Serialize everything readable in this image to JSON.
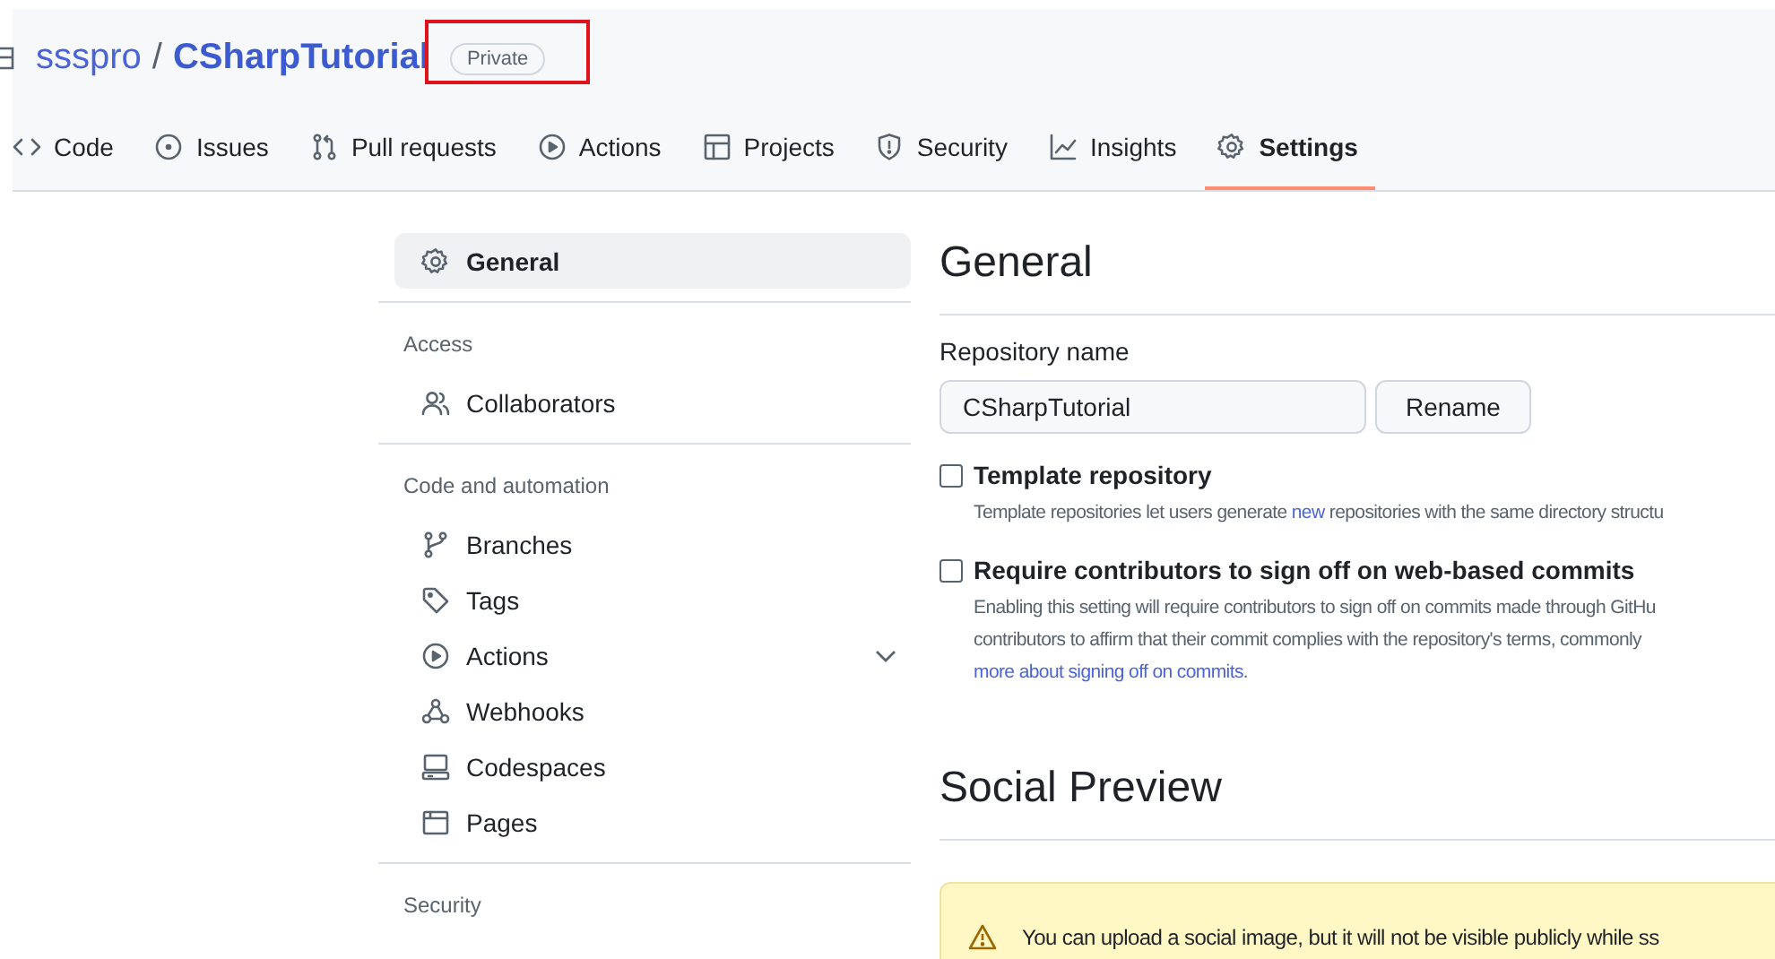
{
  "repo": {
    "owner": "ssspro",
    "separator": "/",
    "name": "CSharpTutorial",
    "visibility": "Private",
    "highlighted": true
  },
  "tabs": [
    {
      "label": "Code",
      "selected": false
    },
    {
      "label": "Issues",
      "selected": false
    },
    {
      "label": "Pull requests",
      "selected": false
    },
    {
      "label": "Actions",
      "selected": false
    },
    {
      "label": "Projects",
      "selected": false
    },
    {
      "label": "Security",
      "selected": false
    },
    {
      "label": "Insights",
      "selected": false
    },
    {
      "label": "Settings",
      "selected": true
    }
  ],
  "sidebar": {
    "sections": [
      {
        "items": [
          {
            "label": "General",
            "selected": true
          }
        ]
      },
      {
        "heading": "Access",
        "items": [
          {
            "label": "Collaborators",
            "selected": false
          }
        ]
      },
      {
        "heading": "Code and automation",
        "items": [
          {
            "label": "Branches",
            "selected": false
          },
          {
            "label": "Tags",
            "selected": false
          },
          {
            "label": "Actions",
            "selected": false,
            "expanded": false
          },
          {
            "label": "Webhooks",
            "selected": false
          },
          {
            "label": "Codespaces",
            "selected": false
          },
          {
            "label": "Pages",
            "selected": false
          }
        ]
      },
      {
        "heading": "Security"
      }
    ]
  },
  "main": {
    "title": "General",
    "field": {
      "label": "Repository name",
      "value": "CSharpTutorial",
      "button": "Rename"
    },
    "options": [
      {
        "label": "Template repository",
        "checked": false,
        "description": [
          [
            {
              "text": "Template repositories let users generate ",
              "link": false
            },
            {
              "text": "new",
              "link": true
            },
            {
              "text": " repositories with the same directory structu",
              "link": false
            }
          ]
        ]
      },
      {
        "label": "Require contributors to sign off on web-based commits",
        "checked": false,
        "description": [
          [
            {
              "text": "Enabling this setting will require contributors to sign off on commits made through GitHu",
              "link": false
            }
          ],
          [
            {
              "text": "contributors to affirm that their commit complies with the repository's terms, commonly",
              "link": false
            }
          ],
          [
            {
              "text": "more about signing off on commits",
              "link": true
            },
            {
              "text": ".",
              "link": false
            }
          ]
        ]
      }
    ],
    "section_title": "Social Preview",
    "alert": "You can upload a social image, but it will not be visible publicly while ss"
  }
}
